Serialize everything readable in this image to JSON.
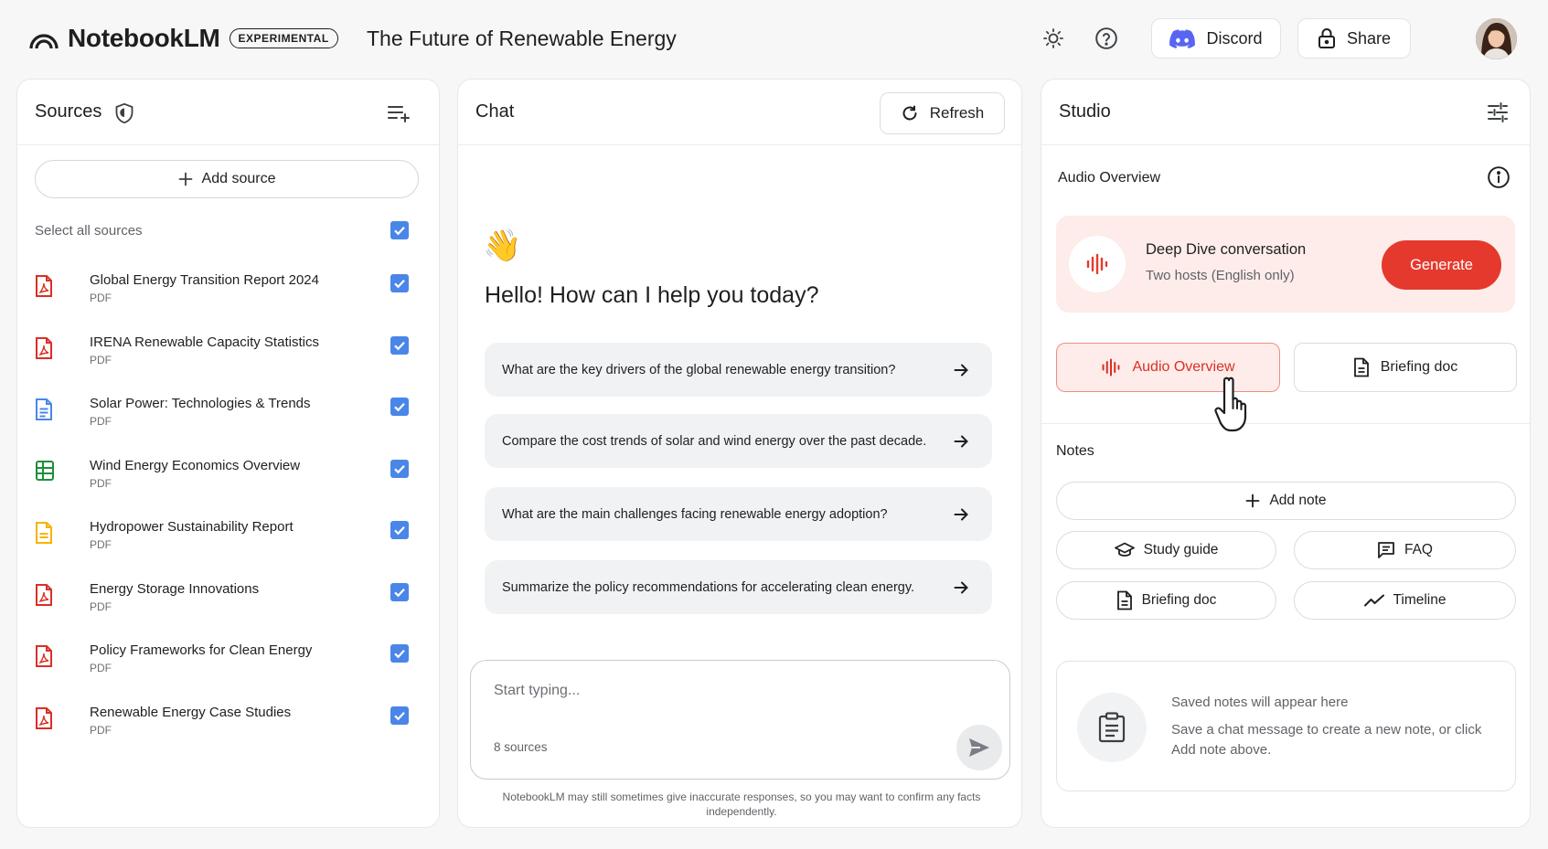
{
  "app": {
    "name": "NotebookLM",
    "badge": "EXPERIMENTAL"
  },
  "notebook": {
    "title": "The Future of Renewable Energy"
  },
  "header": {
    "theme_icon": "sun-icon",
    "help_icon": "help-circle-icon",
    "discord_label": "Discord",
    "share_label": "Share"
  },
  "sources": {
    "title": "Sources",
    "add_label": "Add source",
    "select_all_label": "Select all sources",
    "items": [
      {
        "name": "Global Energy Transition Report 2024",
        "type": "PDF",
        "icon": "pdf-icon",
        "color": "#d93025"
      },
      {
        "name": "IRENA Renewable Capacity Statistics",
        "type": "PDF",
        "icon": "pdf-icon",
        "color": "#d93025"
      },
      {
        "name": "Solar Power: Technologies & Trends",
        "type": "PDF",
        "icon": "doc-icon",
        "color": "#4a86e8"
      },
      {
        "name": "Wind Energy Economics Overview",
        "type": "PDF",
        "icon": "sheet-icon",
        "color": "#1e8e3e"
      },
      {
        "name": "Hydropower Sustainability Report",
        "type": "PDF",
        "icon": "slides-icon",
        "color": "#f4b400"
      },
      {
        "name": "Energy Storage Innovations",
        "type": "PDF",
        "icon": "pdf-icon",
        "color": "#d93025"
      },
      {
        "name": "Policy Frameworks for Clean Energy",
        "type": "PDF",
        "icon": "pdf-icon",
        "color": "#d93025"
      },
      {
        "name": "Renewable Energy Case Studies",
        "type": "PDF",
        "icon": "pdf-icon",
        "color": "#d93025"
      }
    ]
  },
  "chat": {
    "title": "Chat",
    "refresh_label": "Refresh",
    "emoji": "👋",
    "greeting": "Hello! How can I help you today?",
    "suggestions": [
      "What are the key drivers of the global renewable energy transition?",
      "Compare the cost trends of solar and wind energy over the past decade.",
      "What are the main challenges facing renewable energy adoption?",
      "Summarize the policy recommendations for accelerating clean energy."
    ],
    "input_placeholder": "Start typing...",
    "source_count": "8 sources",
    "disclaimer": "NotebookLM may still sometimes give inaccurate responses, so you may want to confirm any facts independently."
  },
  "studio": {
    "title": "Studio",
    "audio_overview_label": "Audio Overview",
    "deep_dive_title": "Deep Dive conversation",
    "deep_dive_sub": "Two hosts (English only)",
    "generate_label": "Generate",
    "tile_audio_label": "Audio Overview",
    "tile_briefing_label": "Briefing doc",
    "notes_label": "Notes",
    "add_note_label": "Add note",
    "study_guide_label": "Study guide",
    "faq_label": "FAQ",
    "briefing_doc_label": "Briefing doc",
    "timeline_label": "Timeline",
    "empty_title": "Saved notes will appear here",
    "empty_desc": "Save a chat message to create a new note, or click Add note above."
  },
  "colors": {
    "accent_red": "#e5392d",
    "checkbox_blue": "#4a86e8",
    "discord_blue": "#5865f2"
  }
}
